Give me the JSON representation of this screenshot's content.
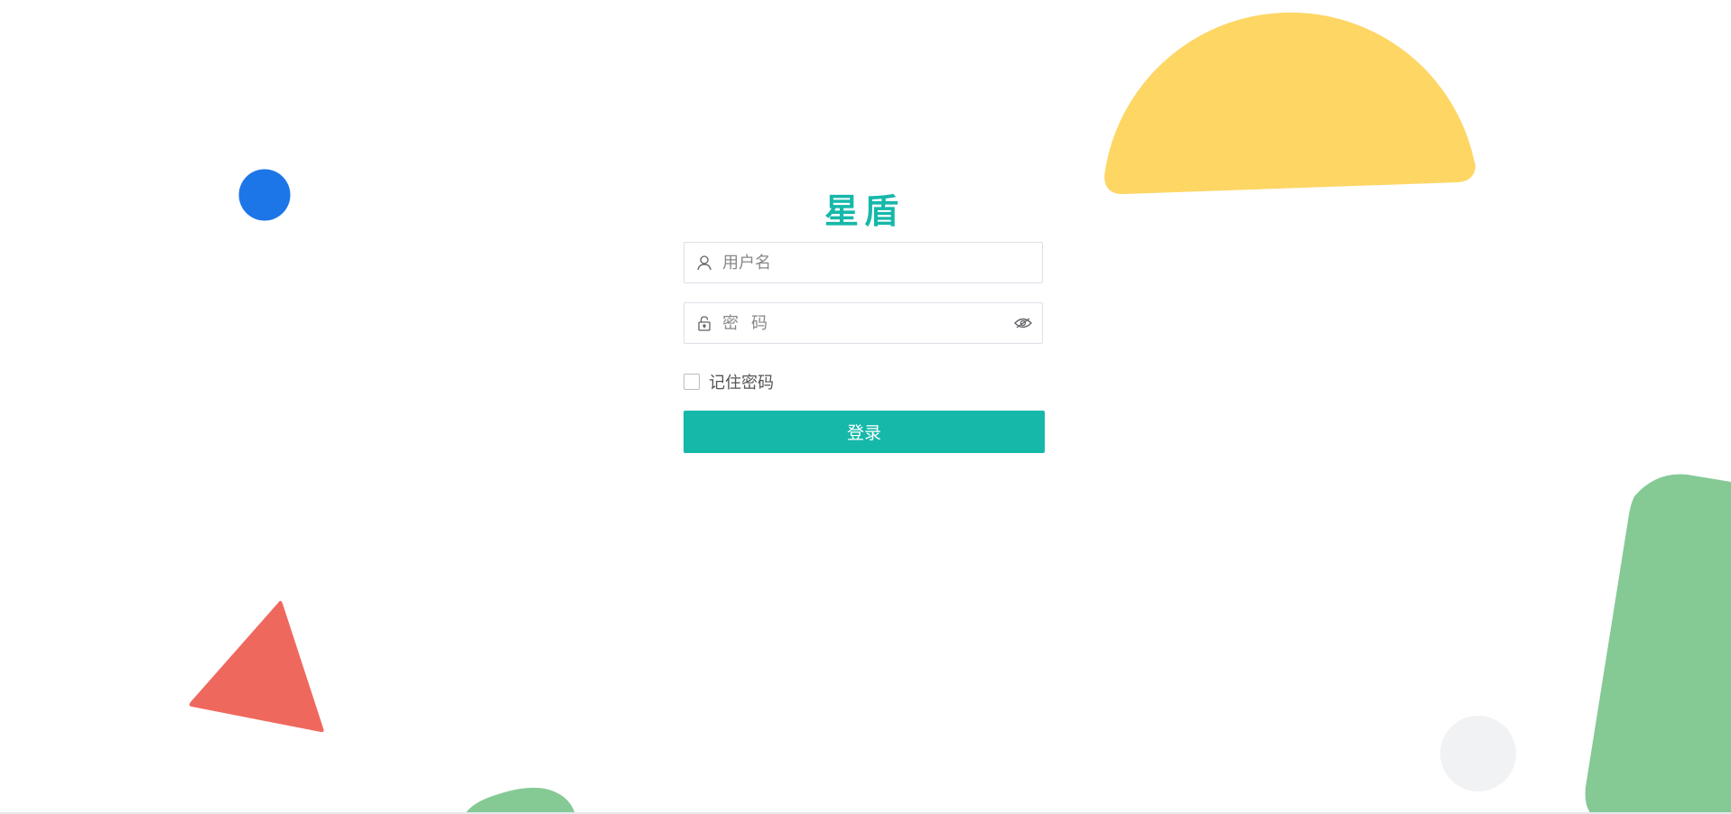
{
  "brand": {
    "title": "星盾",
    "accent": "#16b8aa"
  },
  "form": {
    "username": {
      "placeholder": "用户名",
      "value": "",
      "icon": "user-icon"
    },
    "password": {
      "placeholder": "密码",
      "value": "",
      "icon": "lock-icon",
      "toggle_icon": "eye-icon"
    },
    "remember": {
      "label": "记住密码",
      "checked": false
    },
    "submit_label": "登录"
  },
  "decorations": {
    "colors": {
      "yellow": "#fdd664",
      "blue": "#1c76e8",
      "red": "#ef685e",
      "green": "#85c995",
      "gray": "#f1f2f4"
    }
  }
}
